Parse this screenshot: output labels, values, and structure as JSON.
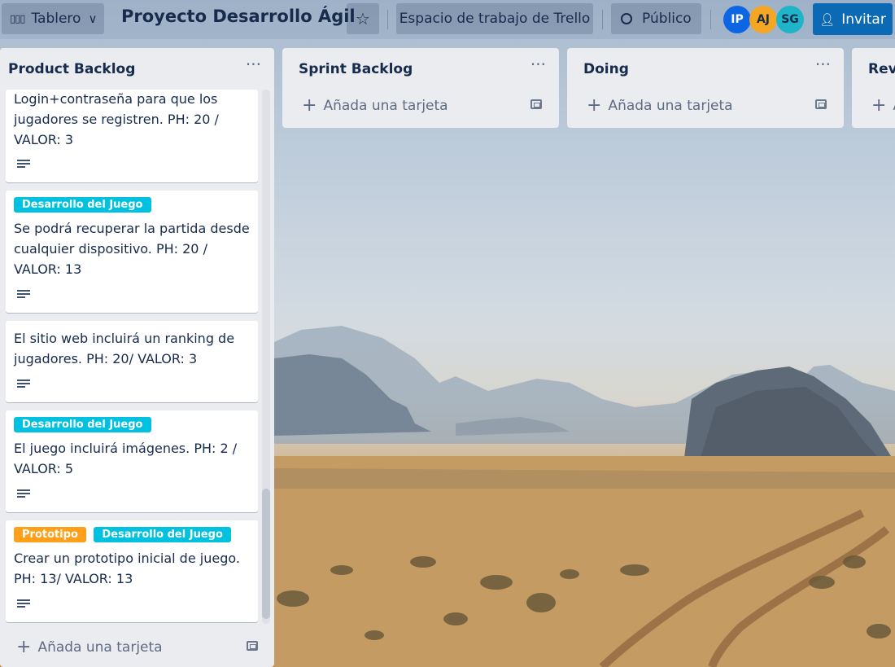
{
  "header": {
    "board_switch_label": "Tablero",
    "board_title": "Proyecto Desarrollo Ágil",
    "workspace_label": "Espacio de trabajo de Trello",
    "visibility_label": "Público",
    "invite_label": "Invitar",
    "members": [
      {
        "initials": "IP",
        "color": "#0c66e4"
      },
      {
        "initials": "AJ",
        "color": "#f5a623"
      },
      {
        "initials": "SG",
        "color": "#1fb5c9"
      }
    ]
  },
  "lists": [
    {
      "title": "Product Backlog",
      "add_card": "Añada una tarjeta",
      "cards": [
        {
          "labels": [],
          "text": "Login+contraseña para que los jugadores se registren. PH: 20 / VALOR: 3"
        },
        {
          "labels": [
            "Desarrollo del Juego"
          ],
          "text": "Se podrá recuperar la partida desde cualquier dispositivo. PH: 20 / VALOR: 13"
        },
        {
          "labels": [],
          "text": "El sitio web incluirá un ranking de jugadores. PH: 20/ VALOR: 3"
        },
        {
          "labels": [
            "Desarrollo del Juego"
          ],
          "text": "El juego incluirá imágenes. PH: 2 / VALOR: 5"
        },
        {
          "labels": [
            "Prototipo",
            "Desarrollo del Juego"
          ],
          "text": "Crear un prototipo inicial de juego. PH: 13/ VALOR: 13"
        }
      ]
    },
    {
      "title": "Sprint Backlog",
      "add_card": "Añada una tarjeta"
    },
    {
      "title": "Doing",
      "add_card": "Añada una tarjeta"
    },
    {
      "title": "Revi",
      "add_card": "A"
    }
  ],
  "label_colors": {
    "Desarrollo del Juego": "#00c2e0",
    "Prototipo": "#ff9f1a"
  },
  "icons": [
    "board-icon",
    "chevron-down-icon",
    "star-icon",
    "globe-icon",
    "add-member-icon",
    "more-icon",
    "plus-icon",
    "template-icon",
    "description-icon"
  ]
}
